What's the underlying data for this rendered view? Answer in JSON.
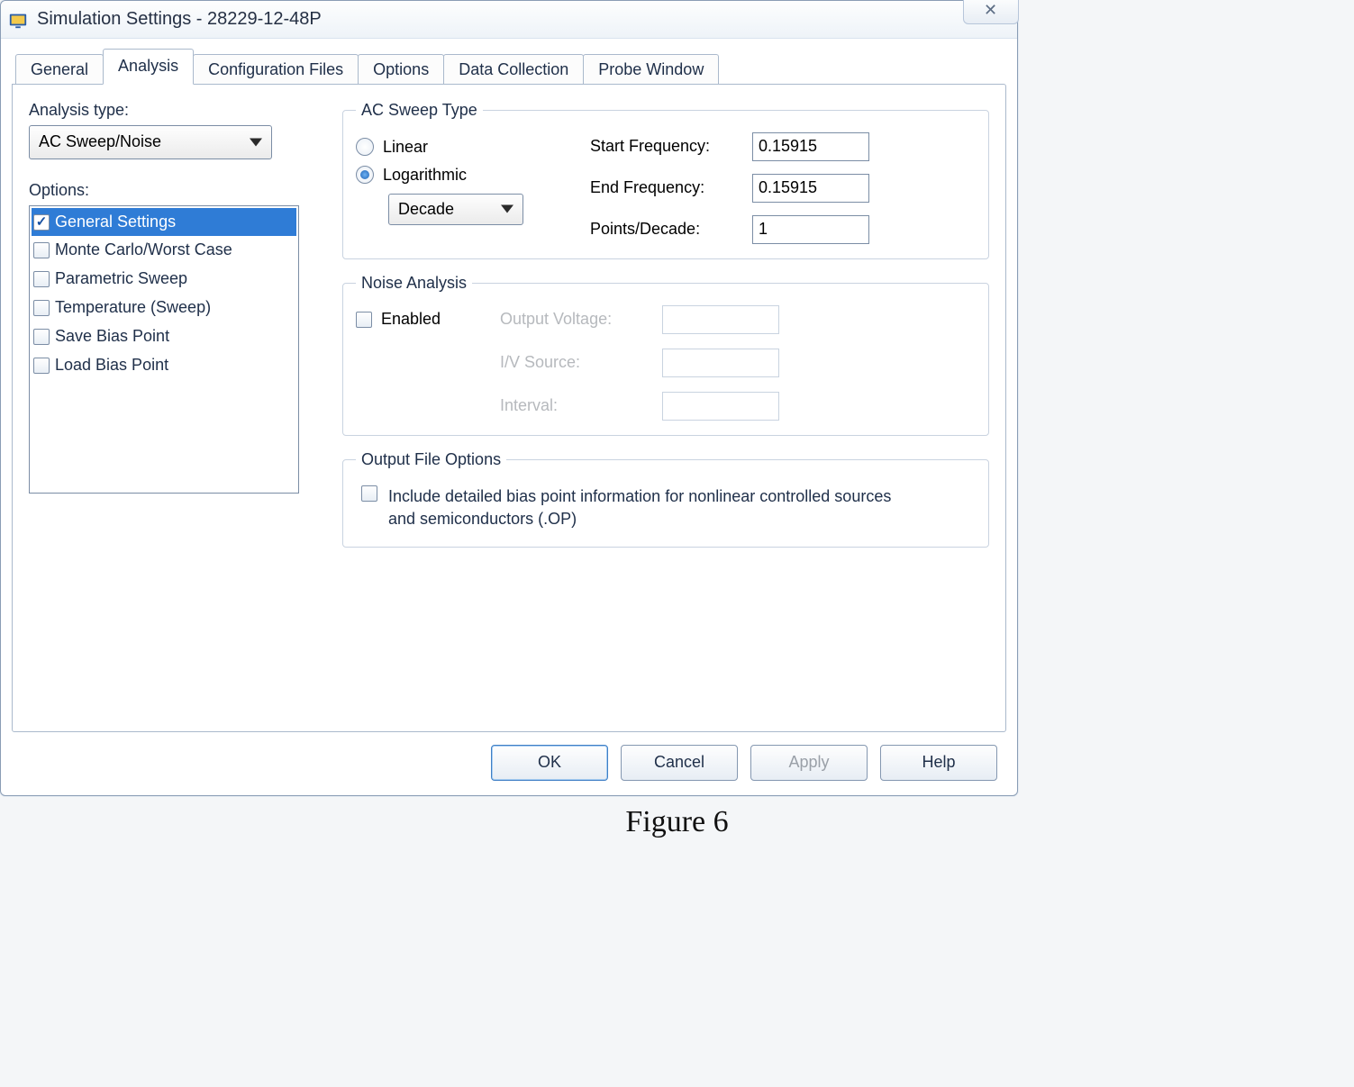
{
  "window": {
    "title": "Simulation Settings - 28229-12-48P",
    "close_glyph": "✕"
  },
  "tabs": [
    {
      "label": "General",
      "active": false
    },
    {
      "label": "Analysis",
      "active": true
    },
    {
      "label": "Configuration Files",
      "active": false
    },
    {
      "label": "Options",
      "active": false
    },
    {
      "label": "Data Collection",
      "active": false
    },
    {
      "label": "Probe Window",
      "active": false
    }
  ],
  "analysis": {
    "type_label": "Analysis type:",
    "type_value": "AC Sweep/Noise",
    "options_label": "Options:",
    "options_items": [
      {
        "label": "General Settings",
        "checked": true,
        "selected": true
      },
      {
        "label": "Monte Carlo/Worst Case",
        "checked": false,
        "selected": false
      },
      {
        "label": "Parametric Sweep",
        "checked": false,
        "selected": false
      },
      {
        "label": "Temperature (Sweep)",
        "checked": false,
        "selected": false
      },
      {
        "label": "Save Bias Point",
        "checked": false,
        "selected": false
      },
      {
        "label": "Load Bias Point",
        "checked": false,
        "selected": false
      }
    ]
  },
  "sweep": {
    "legend": "AC Sweep Type",
    "linear_label": "Linear",
    "log_label": "Logarithmic",
    "selected": "log",
    "scale_value": "Decade",
    "fields": {
      "start_label": "Start Frequency:",
      "start_value": "0.15915",
      "end_label": "End Frequency:",
      "end_value": "0.15915",
      "ppd_label": "Points/Decade:",
      "ppd_value": "1"
    }
  },
  "noise": {
    "legend": "Noise Analysis",
    "enabled_label": "Enabled",
    "enabled": false,
    "out_v_label": "Output Voltage:",
    "iv_label": "I/V Source:",
    "interval_label": "Interval:",
    "out_v_value": "",
    "iv_value": "",
    "interval_value": ""
  },
  "output_file": {
    "legend": "Output File Options",
    "bias_checked": false,
    "bias_label": "Include detailed bias point information for nonlinear controlled sources and semiconductors (.OP)"
  },
  "buttons": {
    "ok": "OK",
    "cancel": "Cancel",
    "apply": "Apply",
    "help": "Help"
  },
  "caption": "Figure 6"
}
